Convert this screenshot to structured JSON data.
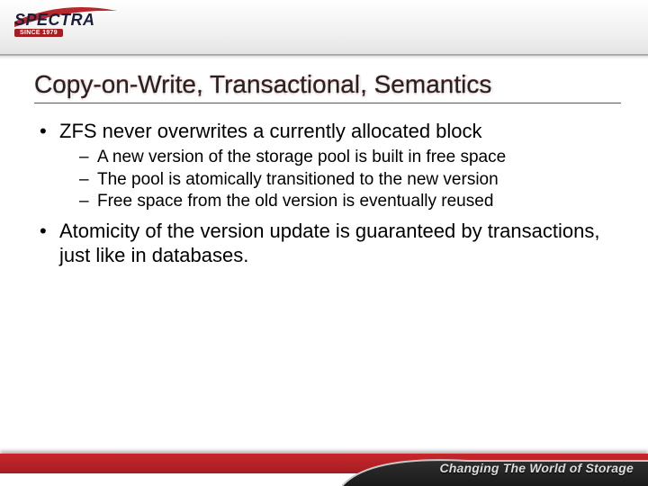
{
  "logo": {
    "brand": "SPECTRA",
    "since": "SINCE 1979"
  },
  "title": "Copy-on-Write, Transactional, Semantics",
  "bullets": [
    {
      "text": "ZFS never overwrites a currently allocated block",
      "sub": [
        "A new version of the storage pool is built in free space",
        "The pool is atomically transitioned to the new version",
        "Free space from the old version is eventually reused"
      ]
    },
    {
      "text": "Atomicity of the version update is guaranteed by transactions, just like in databases.",
      "sub": []
    }
  ],
  "tagline": "Changing The World of Storage"
}
